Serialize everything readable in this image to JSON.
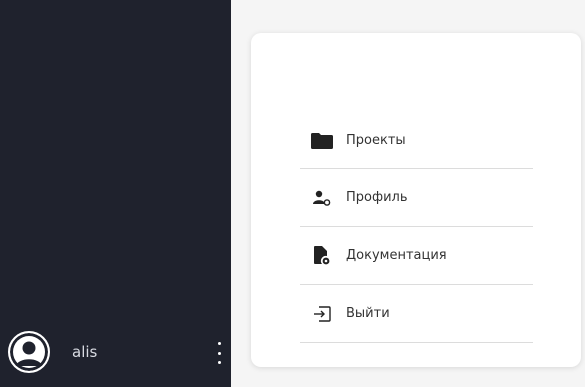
{
  "user": {
    "name": "alis",
    "avatar_icon": "user-avatar-icon",
    "more_icon": "more-vertical-icon"
  },
  "menu": {
    "items": [
      {
        "label": "Проекты",
        "icon": "folder-icon"
      },
      {
        "label": "Профиль",
        "icon": "profile-settings-icon"
      },
      {
        "label": "Документация",
        "icon": "document-settings-icon"
      },
      {
        "label": "Выйти",
        "icon": "logout-icon"
      }
    ]
  },
  "colors": {
    "sidebar_bg": "#1f222d",
    "page_bg": "#f5f5f5",
    "card_bg": "#ffffff",
    "icon_color": "#222222",
    "text_color": "#333333",
    "divider": "#dcdcdc"
  }
}
